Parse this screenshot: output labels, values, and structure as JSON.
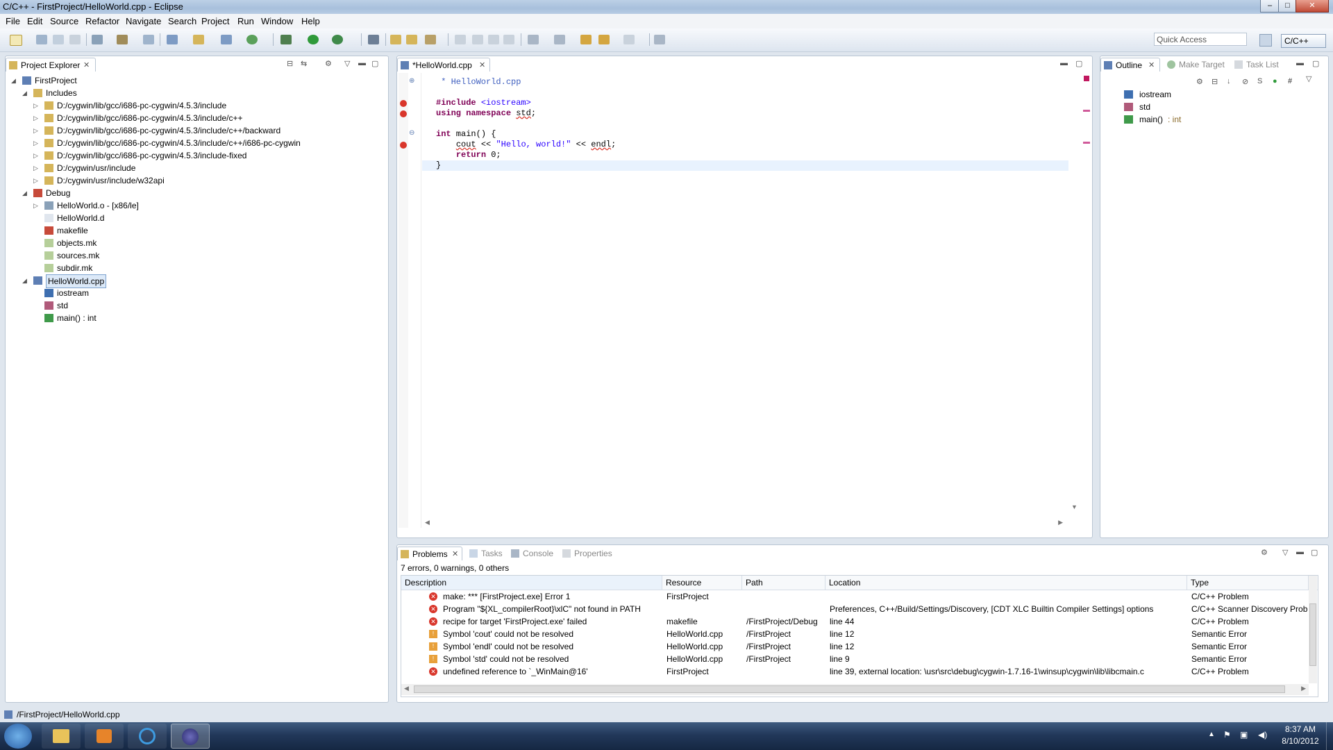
{
  "window": {
    "title": "C/C++ - FirstProject/HelloWorld.cpp - Eclipse",
    "controls": [
      "–",
      "□",
      "✕"
    ]
  },
  "menu": [
    "File",
    "Edit",
    "Source",
    "Refactor",
    "Navigate",
    "Search",
    "Project",
    "Run",
    "Window",
    "Help"
  ],
  "toolbar": {
    "quick_access_placeholder": "Quick Access",
    "perspective": "C/C++"
  },
  "project_explorer": {
    "tab_label": "Project Explorer",
    "tree": [
      {
        "label": "FirstProject",
        "icon": "project-icon",
        "depth": 0,
        "arrow": "◢"
      },
      {
        "label": "Includes",
        "icon": "includes-icon",
        "depth": 1,
        "arrow": "◢"
      },
      {
        "label": "D:/cygwin/lib/gcc/i686-pc-cygwin/4.5.3/include",
        "icon": "folder-include-icon",
        "depth": 2,
        "arrow": "▷"
      },
      {
        "label": "D:/cygwin/lib/gcc/i686-pc-cygwin/4.5.3/include/c++",
        "icon": "folder-include-icon",
        "depth": 2,
        "arrow": "▷"
      },
      {
        "label": "D:/cygwin/lib/gcc/i686-pc-cygwin/4.5.3/include/c++/backward",
        "icon": "folder-include-icon",
        "depth": 2,
        "arrow": "▷"
      },
      {
        "label": "D:/cygwin/lib/gcc/i686-pc-cygwin/4.5.3/include/c++/i686-pc-cygwin",
        "icon": "folder-include-icon",
        "depth": 2,
        "arrow": "▷"
      },
      {
        "label": "D:/cygwin/lib/gcc/i686-pc-cygwin/4.5.3/include-fixed",
        "icon": "folder-include-icon",
        "depth": 2,
        "arrow": "▷"
      },
      {
        "label": "D:/cygwin/usr/include",
        "icon": "folder-include-icon",
        "depth": 2,
        "arrow": "▷"
      },
      {
        "label": "D:/cygwin/usr/include/w32api",
        "icon": "folder-include-icon",
        "depth": 2,
        "arrow": "▷"
      },
      {
        "label": "Debug",
        "icon": "debug-folder-icon",
        "depth": 1,
        "arrow": "◢"
      },
      {
        "label": "HelloWorld.o - [x86/le]",
        "icon": "object-file-icon",
        "depth": 2,
        "arrow": "▷"
      },
      {
        "label": "HelloWorld.d",
        "icon": "file-icon",
        "depth": 2,
        "arrow": ""
      },
      {
        "label": "makefile",
        "icon": "makefile-icon",
        "depth": 2,
        "arrow": ""
      },
      {
        "label": "objects.mk",
        "icon": "mk-file-icon",
        "depth": 2,
        "arrow": ""
      },
      {
        "label": "sources.mk",
        "icon": "mk-file-icon",
        "depth": 2,
        "arrow": ""
      },
      {
        "label": "subdir.mk",
        "icon": "mk-file-icon",
        "depth": 2,
        "arrow": ""
      },
      {
        "label": "HelloWorld.cpp",
        "icon": "cpp-file-icon",
        "depth": 1,
        "arrow": "◢",
        "selected": true
      },
      {
        "label": "iostream",
        "icon": "include-icon",
        "depth": 2,
        "arrow": ""
      },
      {
        "label": "std",
        "icon": "namespace-icon",
        "depth": 2,
        "arrow": ""
      },
      {
        "label": "main() : int",
        "icon": "function-icon",
        "depth": 2,
        "arrow": ""
      }
    ]
  },
  "editor": {
    "tab_label": "*HelloWorld.cpp",
    "lines": [
      {
        "text": " * HelloWorld.cpp",
        "fold": "⊕",
        "color": "#3f5fbf"
      },
      {
        "text": "",
        "fold": ""
      },
      {
        "text": "#include <iostream>",
        "fold": "",
        "marker": true
      },
      {
        "text": "using namespace std;",
        "fold": "",
        "marker": true
      },
      {
        "text": "",
        "fold": ""
      },
      {
        "text": "int main() {",
        "fold": "⊖"
      },
      {
        "text": "    cout << \"Hello, world!\" << endl;",
        "fold": "",
        "marker": true
      },
      {
        "text": "    return 0;",
        "fold": ""
      },
      {
        "text": "}",
        "fold": "",
        "current": true
      }
    ]
  },
  "outline": {
    "tabs": [
      "Outline",
      "Make Target",
      "Task List"
    ],
    "items": [
      {
        "label": "iostream",
        "icon": "include-icon"
      },
      {
        "label": "std",
        "icon": "namespace-icon"
      },
      {
        "label": "main()",
        "suffix": " : int",
        "icon": "function-icon"
      }
    ]
  },
  "problems": {
    "tabs": [
      "Problems",
      "Tasks",
      "Console",
      "Properties"
    ],
    "summary": "7 errors, 0 warnings, 0 others",
    "columns": [
      "Description",
      "Resource",
      "Path",
      "Location",
      "Type"
    ],
    "rows": [
      {
        "kind": "error",
        "description": "make: *** [FirstProject.exe] Error 1",
        "resource": "FirstProject",
        "path": "",
        "location": "",
        "type": "C/C++ Problem"
      },
      {
        "kind": "error",
        "description": "Program \"${XL_compilerRoot}\\xlC\" not found in PATH",
        "resource": "",
        "path": "",
        "location": "Preferences, C++/Build/Settings/Discovery, [CDT XLC Builtin Compiler Settings] options",
        "type": "C/C++ Scanner Discovery Proble"
      },
      {
        "kind": "error",
        "description": "recipe for target 'FirstProject.exe' failed",
        "resource": "makefile",
        "path": "/FirstProject/Debug",
        "location": "line 44",
        "type": "C/C++ Problem"
      },
      {
        "kind": "semantic",
        "description": "Symbol 'cout' could not be resolved",
        "resource": "HelloWorld.cpp",
        "path": "/FirstProject",
        "location": "line 12",
        "type": "Semantic Error"
      },
      {
        "kind": "semantic",
        "description": "Symbol 'endl' could not be resolved",
        "resource": "HelloWorld.cpp",
        "path": "/FirstProject",
        "location": "line 12",
        "type": "Semantic Error"
      },
      {
        "kind": "semantic",
        "description": "Symbol 'std' could not be resolved",
        "resource": "HelloWorld.cpp",
        "path": "/FirstProject",
        "location": "line 9",
        "type": "Semantic Error"
      },
      {
        "kind": "error",
        "description": "undefined reference to `_WinMain@16'",
        "resource": "FirstProject",
        "path": "",
        "location": "line 39, external location: \\usr\\src\\debug\\cygwin-1.7.16-1\\winsup\\cygwin\\lib\\libcmain.c",
        "type": "C/C++ Problem"
      }
    ]
  },
  "status_bar": {
    "text": "/FirstProject/HelloWorld.cpp"
  },
  "taskbar": {
    "time": "8:37 AM",
    "date": "8/10/2012"
  },
  "colors": {
    "accent": "#7da2ce",
    "error": "#d9362b",
    "keyword": "#7f0055",
    "string": "#2a00ff",
    "comment": "#3f5fbf"
  }
}
